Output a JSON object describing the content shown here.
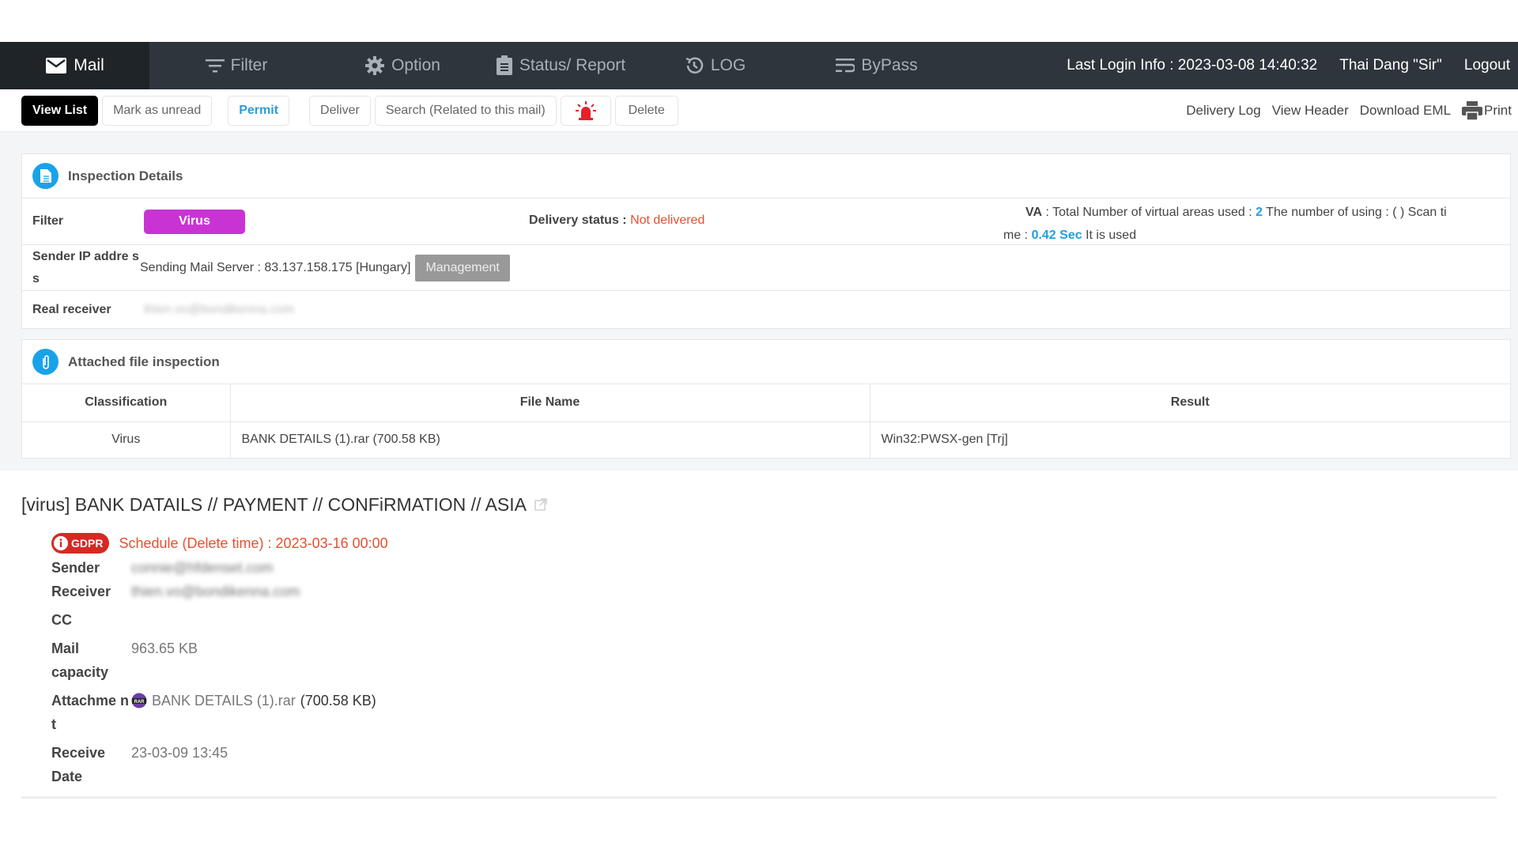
{
  "nav": {
    "items": [
      {
        "label": "Mail",
        "icon": "envelope-icon",
        "active": true
      },
      {
        "label": "Filter",
        "icon": "filter-icon"
      },
      {
        "label": "Option",
        "icon": "gear-icon"
      },
      {
        "label": "Status/ Report",
        "icon": "clipboard-icon"
      },
      {
        "label": "LOG",
        "icon": "history-icon"
      },
      {
        "label": "ByPass",
        "icon": "bypass-icon"
      }
    ],
    "last_login": "Last Login Info : 2023-03-08 14:40:32",
    "user": "Thai Dang \"Sir\"",
    "logout": "Logout"
  },
  "toolbar": {
    "view_list": "View List",
    "mark_unread": "Mark as unread",
    "permit": "Permit",
    "deliver": "Deliver",
    "search_related": "Search (Related to this mail)",
    "alarm_icon": "siren-icon",
    "delete": "Delete",
    "delivery_log": "Delivery Log",
    "view_header": "View Header",
    "download_eml": "Download EML",
    "print": "Print"
  },
  "inspection": {
    "title": "Inspection Details",
    "filter_label": "Filter",
    "filter_value": "Virus",
    "delivery_status_label": "Delivery status : ",
    "delivery_status_value": "Not delivered",
    "va_label": "VA",
    "va_text1": " : Total Number of virtual areas used : ",
    "va_count": "2",
    "va_text2": " The number of using : ( ) Scan ti",
    "va_text3": "me : ",
    "scan_time": "0.42 Sec",
    "va_text4": " It is used",
    "sender_ip_label": "Sender IP addre ss",
    "sender_ip_value": "Sending Mail Server : 83.137.158.175 [Hungary]",
    "management": "Management",
    "real_receiver_label": "Real receiver",
    "real_receiver_value": "thien.vo@bondikenna.com"
  },
  "attachment_inspection": {
    "title": "Attached file inspection",
    "columns": [
      "Classification",
      "File Name",
      "Result"
    ],
    "rows": [
      {
        "classification": "Virus",
        "file_name": "BANK DETAILS (1).rar (700.58 KB)",
        "result": "Win32:PWSX-gen [Trj]"
      }
    ]
  },
  "mail": {
    "subject": "[virus] BANK DATAILS // PAYMENT // CONFiRMATION // ASIA",
    "gdpr_badge": "GDPR",
    "schedule": "Schedule (Delete time) : 2023-03-16 00:00",
    "sender_label": "Sender",
    "sender_value": "connie@hfdenset.com",
    "receiver_label": "Receiver",
    "receiver_value": "thien.vo@bondikenna.com",
    "cc_label": "CC",
    "cc_value": "",
    "capacity_label": "Mail capacity",
    "capacity_value": "963.65 KB",
    "attachment_label": "Attachme nt",
    "attachment_name": "BANK DETAILS (1).rar",
    "attachment_size": "(700.58 KB)",
    "receive_date_label": "Receive Date",
    "receive_date_value": "23-03-09 13:45"
  },
  "colors": {
    "nav_bg": "#2e353c",
    "virus_badge": "#c933d4",
    "alert_red": "#e8502e",
    "accent_blue": "#1fa0e0"
  }
}
